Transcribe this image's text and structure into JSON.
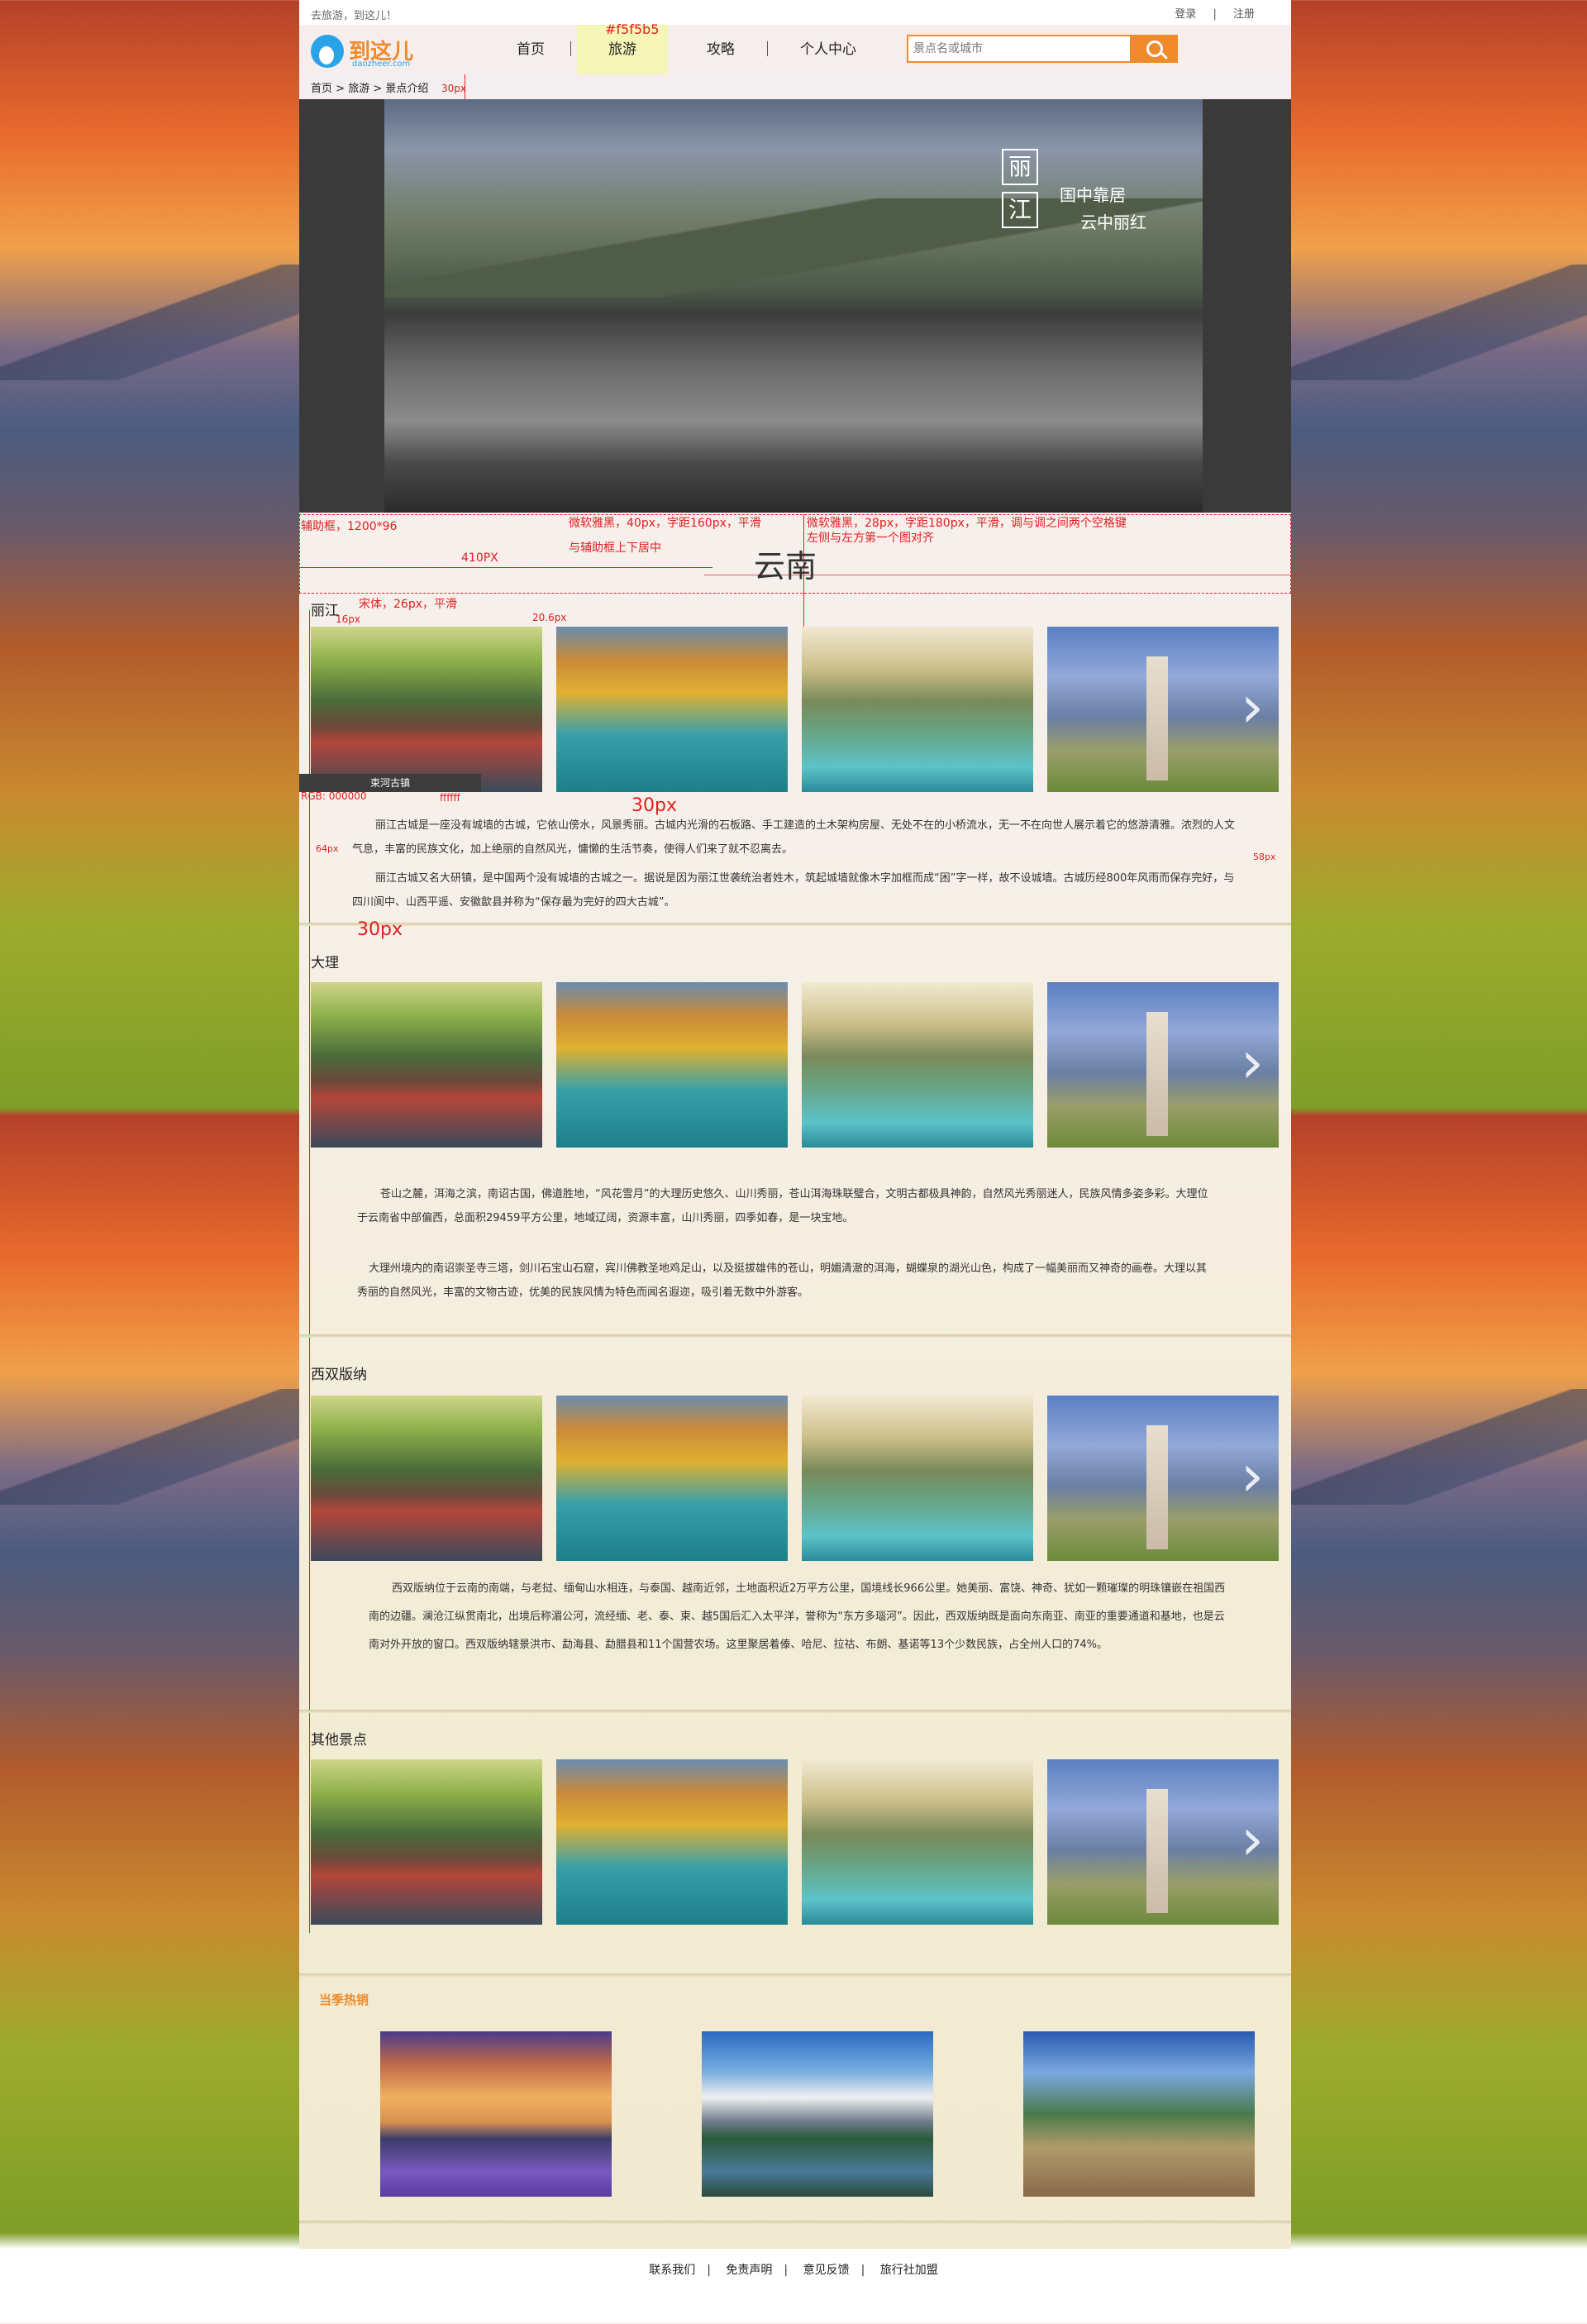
{
  "topbar": {
    "greeting": "去旅游，到这儿！",
    "login": "登录",
    "sep": "|",
    "register": "注册"
  },
  "logo": {
    "name": "到这儿",
    "sub": "daozheer.com"
  },
  "nav": {
    "items": [
      "首页",
      "旅游",
      "攻略",
      "个人中心"
    ],
    "active_color_note": "#f5f5b5"
  },
  "search": {
    "placeholder": "景点名或城市"
  },
  "crumb": [
    "首页",
    ">",
    "旅游",
    ">",
    "景点介绍"
  ],
  "anno": {
    "px30": "30px",
    "box": "辅助框，1200*96",
    "title_spec": "微软雅黑，40px，字距160px，平滑",
    "title_spec2": "与辅助框上下居中",
    "sub_spec": "微软雅黑，28px，字距180px，平滑，调与调之间两个空格键",
    "sub_spec2": "左侧与左方第一个图对齐",
    "w410": "410PX",
    "font_spec": "宋体，26px，平滑",
    "w16": "16px",
    "w20": "20.6px",
    "px30b": "30px",
    "px30c": "30px",
    "w64": "64px",
    "w58": "58px",
    "rgb": "RGB: 000000",
    "white": "ffffff"
  },
  "banner": {
    "chars": [
      "丽",
      "江"
    ],
    "slogan1": "国中靠居",
    "slogan2": "云中丽红"
  },
  "region_title": "云南",
  "sections": [
    {
      "title": "丽江",
      "desc": [
        "丽江古城是一座没有城墙的古城，它依山傍水，风景秀丽。古城内光滑的石板路、手工建造的土木架构房屋、无处不在的小桥流水，无一不在向世人展示着它的悠游清雅。浓烈的人文气息，丰富的民族文化，加上绝丽的自然风光，慵懒的生活节奏，使得人们来了就不忍离去。",
        "丽江古城又名大研镇，是中国两个没有城墙的古城之一。据说是因为丽江世袭统治者姓木，筑起城墙就像木字加框而成“困”字一样，故不设城墙。古城历经800年风雨而保存完好，与四川阆中、山西平遥、安徽歙县并称为“保存最为完好的四大古城”。"
      ]
    },
    {
      "title": "大理",
      "desc": [
        "苍山之麓，洱海之滨，南诏古国，佛道胜地，“风花雪月”的大理历史悠久、山川秀丽，苍山洱海珠联璧合，文明古都极具神韵，自然风光秀丽迷人，民族风情多姿多彩。大理位于云南省中部偏西，总面积29459平方公里，地域辽阔，资源丰富，山川秀丽，四季如春，是一块宝地。",
        "大理州境内的南诏崇圣寺三塔，剑川石宝山石窟，宾川佛教圣地鸡足山，以及挺拔雄伟的苍山，明媚清澈的洱海，蝴蝶泉的湖光山色，构成了一幅美丽而又神奇的画卷。大理以其秀丽的自然风光，丰富的文物古迹，优美的民族风情为特色而闻名遐迩，吸引着无数中外游客。"
      ]
    },
    {
      "title": "西双版纳",
      "desc": [
        "西双版纳位于云南的南端，与老挝、缅甸山水相连，与泰国、越南近邻，土地面积近2万平方公里，国境线长966公里。她美丽、富饶、神奇、犹如一颗璀璨的明珠镶嵌在祖国西南的边疆。澜沧江纵贯南北，出境后称湄公河，流经缅、老、泰、柬、越5国后汇入太平洋，誉称为“东方多瑙河”。因此，西双版纳既是面向东南亚、南亚的重要通道和基地，也是云南对外开放的窗口。西双版纳辖景洪市、勐海县、勐腊县和11个国营农场。这里聚居着傣、哈尼、拉祜、布朗、基诺等13个少数民族，占全州人口的74%。"
      ]
    },
    {
      "title": "其他景点",
      "desc": []
    }
  ],
  "caption": "束河古镇",
  "hot": {
    "title": "当季热销"
  },
  "footer": [
    "联系我们",
    "免责声明",
    "意见反馈",
    "旅行社加盟"
  ]
}
